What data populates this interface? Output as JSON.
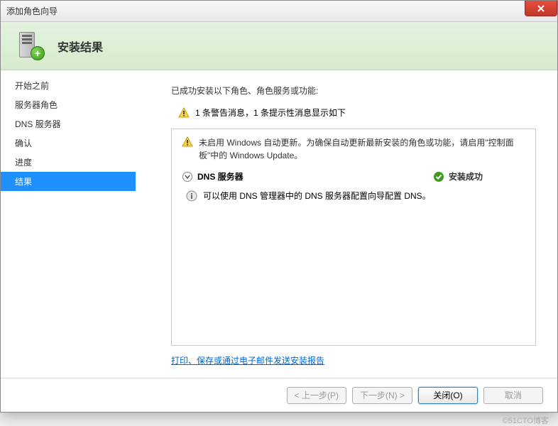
{
  "window": {
    "title": "添加角色向导"
  },
  "header": {
    "title": "安装结果"
  },
  "sidebar": {
    "items": [
      {
        "label": "开始之前"
      },
      {
        "label": "服务器角色"
      },
      {
        "label": "DNS 服务器"
      },
      {
        "label": "确认"
      },
      {
        "label": "进度"
      },
      {
        "label": "结果"
      }
    ],
    "selected_index": 5
  },
  "main": {
    "intro": "已成功安装以下角色、角色服务或功能:",
    "warning_summary": "1 条警告消息，1 条提示性消息显示如下",
    "panel_warning": "未启用 Windows 自动更新。为确保自动更新最新安装的角色或功能，请启用\"控制面板\"中的 Windows Update。",
    "role": {
      "name": "DNS 服务器",
      "status": "安装成功",
      "info": "可以使用 DNS 管理器中的 DNS 服务器配置向导配置 DNS。"
    },
    "report_link": "打印、保存或通过电子邮件发送安装报告"
  },
  "footer": {
    "prev": "< 上一步(P)",
    "next": "下一步(N) >",
    "close": "关闭(O)",
    "cancel": "取消"
  },
  "watermark": "©51CTO博客"
}
